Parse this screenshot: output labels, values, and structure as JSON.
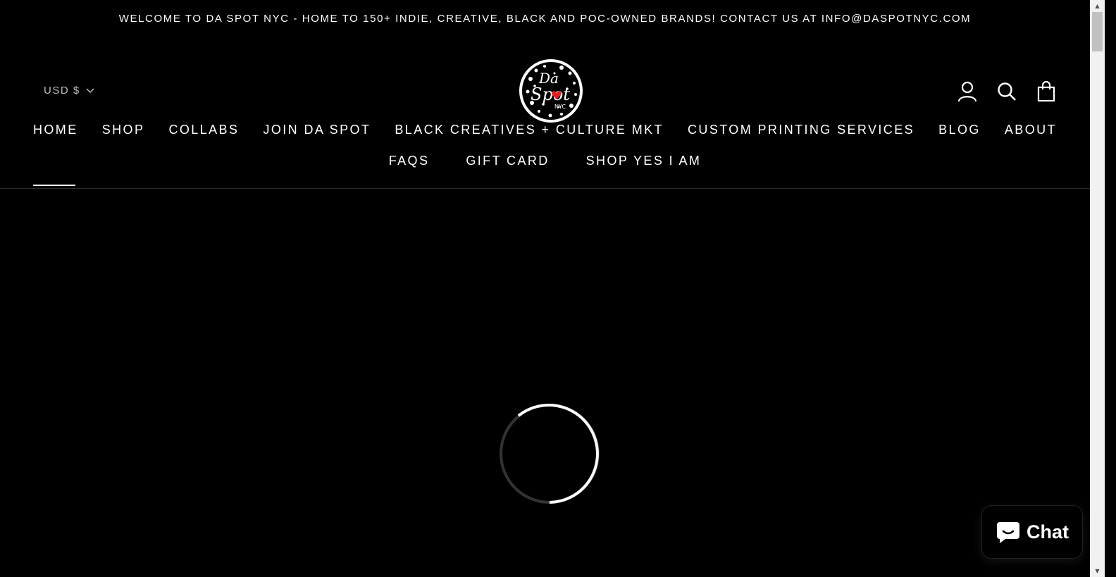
{
  "announcement": {
    "text": "WELCOME TO DA SPOT NYC - HOME TO 150+ INDIE, CREATIVE, BLACK AND POC-OWNED BRANDS! CONTACT US AT INFO@DASPOTNYC.COM"
  },
  "header": {
    "currency": "USD $",
    "logo": {
      "lines": [
        "Da",
        "Spot",
        "NYC"
      ],
      "heart_color": "#e02020"
    },
    "icons": [
      "account-icon",
      "search-icon",
      "cart-icon"
    ]
  },
  "nav": {
    "row1": [
      "HOME",
      "SHOP",
      "COLLABS",
      "JOIN DA SPOT",
      "BLACK CREATIVES + CULTURE MKT",
      "CUSTOM PRINTING SERVICES",
      "BLOG",
      "ABOUT"
    ],
    "row2": [
      "FAQS",
      "GIFT CARD",
      "SHOP YES I AM"
    ],
    "active": "HOME"
  },
  "chat": {
    "label": "Chat"
  },
  "colors": {
    "background": "#000000",
    "text": "#ffffff",
    "spinner_track": "#333333"
  }
}
